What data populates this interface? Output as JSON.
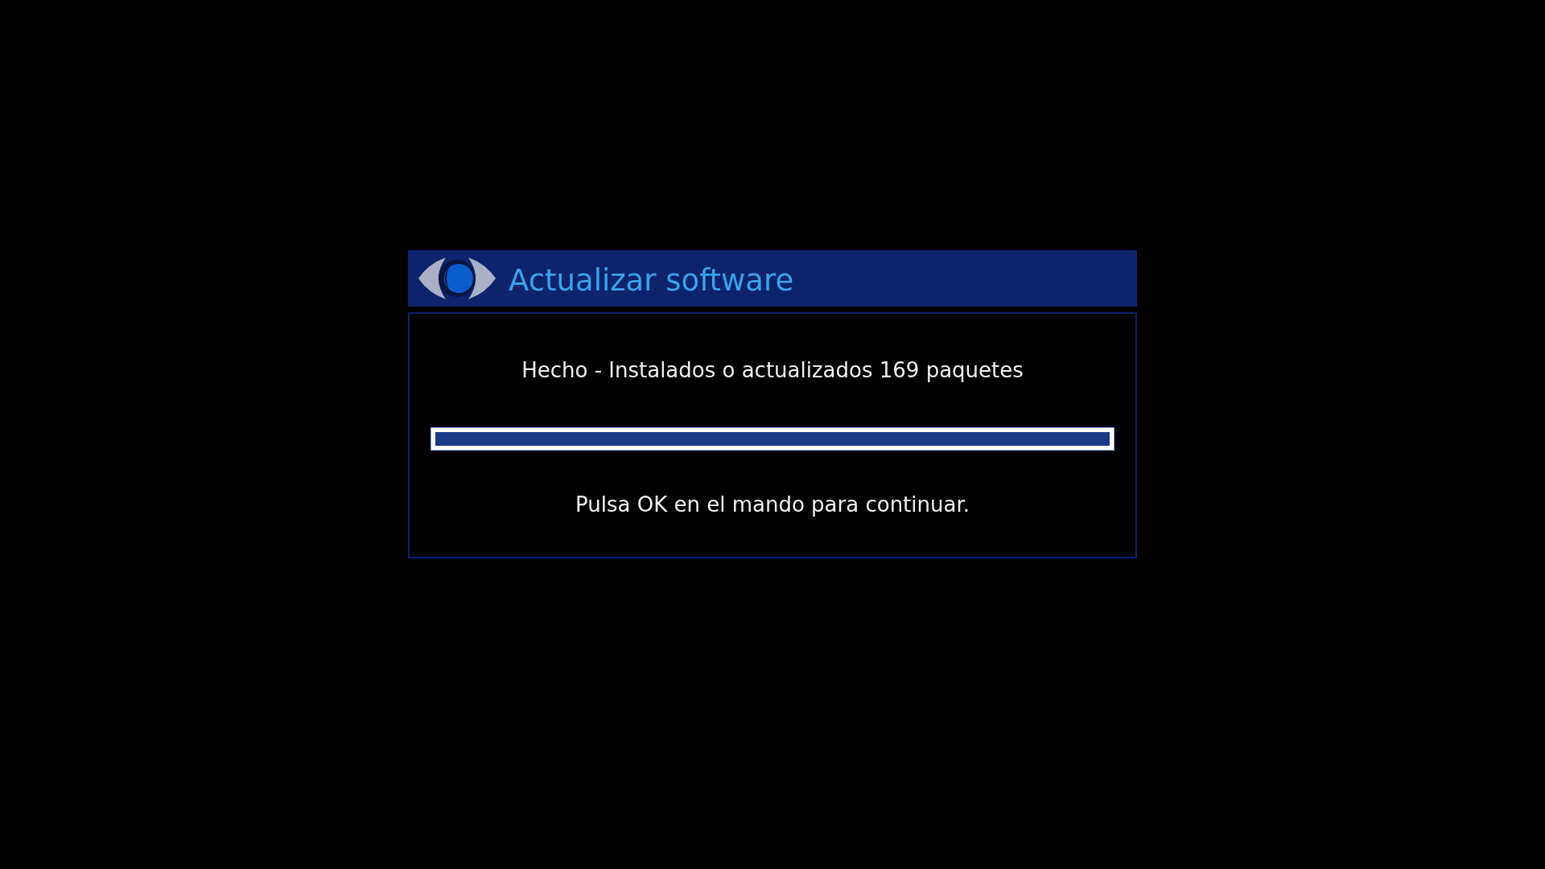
{
  "dialog": {
    "title": "Actualizar software",
    "message": "Hecho - Instalados o actualizados 169 paquetes",
    "progress": {
      "level": 1.0
    },
    "hint": "Pulsa OK en el mando para continuar."
  }
}
